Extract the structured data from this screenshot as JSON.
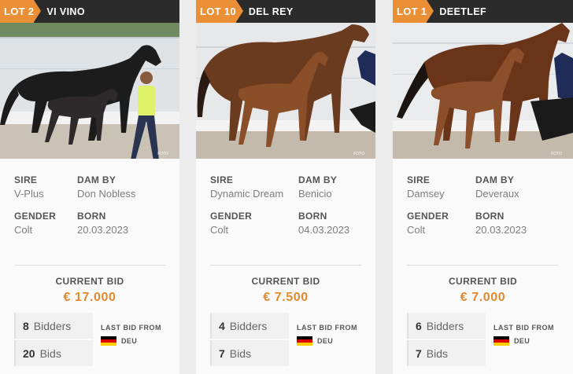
{
  "cards": [
    {
      "lot": "LOT 2",
      "name": "VI VINO",
      "sire_label": "SIRE",
      "sire": "V-Plus",
      "dam_label": "DAM BY",
      "dam": "Don Nobless",
      "gender_label": "GENDER",
      "gender": "Colt",
      "born_label": "BORN",
      "born": "20.03.2023",
      "bid_label": "CURRENT BID",
      "bid": "€ 17.000",
      "bidders_count": "8",
      "bidders_label": "Bidders",
      "bids_count": "20",
      "bids_label": "Bids",
      "last_bid_label": "LAST BID FROM",
      "country": "DEU"
    },
    {
      "lot": "LOT 10",
      "name": "DEL REY",
      "sire_label": "SIRE",
      "sire": "Dynamic Dream",
      "dam_label": "DAM BY",
      "dam": "Benicio",
      "gender_label": "GENDER",
      "gender": "Colt",
      "born_label": "BORN",
      "born": "04.03.2023",
      "bid_label": "CURRENT BID",
      "bid": "€ 7.500",
      "bidders_count": "4",
      "bidders_label": "Bidders",
      "bids_count": "7",
      "bids_label": "Bids",
      "last_bid_label": "LAST BID FROM",
      "country": "DEU"
    },
    {
      "lot": "LOT 1",
      "name": "DEETLEF",
      "sire_label": "SIRE",
      "sire": "Damsey",
      "dam_label": "DAM BY",
      "dam": "Deveraux",
      "gender_label": "GENDER",
      "gender": "Colt",
      "born_label": "BORN",
      "born": "20.03.2023",
      "bid_label": "CURRENT BID",
      "bid": "€ 7.000",
      "bidders_count": "6",
      "bidders_label": "Bidders",
      "bids_count": "7",
      "bids_label": "Bids",
      "last_bid_label": "LAST BID FROM",
      "country": "DEU"
    }
  ],
  "colors": {
    "accent": "#ea8f35",
    "header": "#2b2b2b",
    "bid": "#e2892f"
  },
  "flag_colors": [
    "#000000",
    "#dd0000",
    "#ffce00"
  ]
}
